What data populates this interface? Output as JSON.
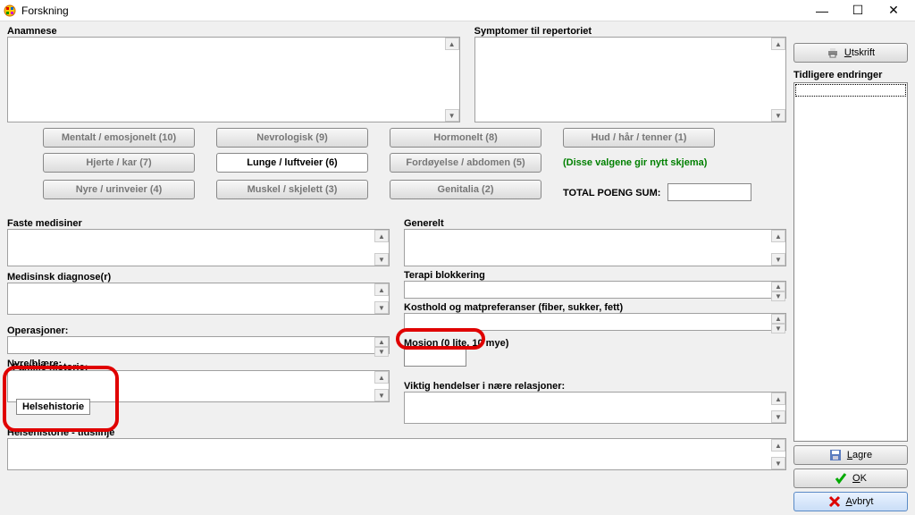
{
  "window": {
    "title": "Forskning"
  },
  "labels": {
    "anamnese": "Anamnese",
    "symptomer": "Symptomer til repertoriet",
    "faste_medisiner": "Faste medisiner",
    "medisinsk_diagnose": "Medisinsk diagnose(r)",
    "operasjoner": "Operasjoner:",
    "nyre_blaere": "Nyre/blære:",
    "familie_historie": "Familie historie:",
    "helsehistorie_tidslinje": "Helsehistorie - tidslinje",
    "generelt": "Generelt",
    "terapi_blokkering": "Terapi blokkering",
    "kosthold": "Kosthold og matpreferanser (fiber, sukker, fett)",
    "mosjon": "Mosjon (0 lite, 10 mye)",
    "viktig_hendelser": "Viktig hendelser i nære relasjoner:",
    "tidligere_endringer": "Tidligere endringer"
  },
  "categories": {
    "mentalt": "Mentalt / emosjonelt (10)",
    "nevrologisk": "Nevrologisk (9)",
    "hormonelt": "Hormonelt (8)",
    "hud": "Hud / hår / tenner (1)",
    "hjerte": "Hjerte / kar (7)",
    "lunge": "Lunge / luftveier (6)",
    "fordoyelse": "Fordøyelse / abdomen (5)",
    "nyre": "Nyre / urinveier (4)",
    "muskel": "Muskel / skjelett (3)",
    "genitalia": "Genitalia (2)"
  },
  "notes": {
    "nytt_skjema": "(Disse valgene gir nytt skjema)",
    "total_poeng": "TOTAL POENG SUM:"
  },
  "tooltip": {
    "helsehistorie": "Helsehistorie"
  },
  "buttons": {
    "utskrift": "Utskrift",
    "lagre": "Lagre",
    "ok": "OK",
    "avbryt": "Avbryt"
  },
  "values": {
    "anamnese": "",
    "symptomer": "",
    "faste_medisiner": "",
    "medisinsk_diagnose": "",
    "operasjoner": "",
    "familie_historie": "",
    "helsehistorie_tidslinje": "",
    "generelt": "",
    "terapi_blokkering": "",
    "kosthold": "",
    "mosjon": "",
    "viktig_hendelser": "",
    "total_poeng": ""
  }
}
